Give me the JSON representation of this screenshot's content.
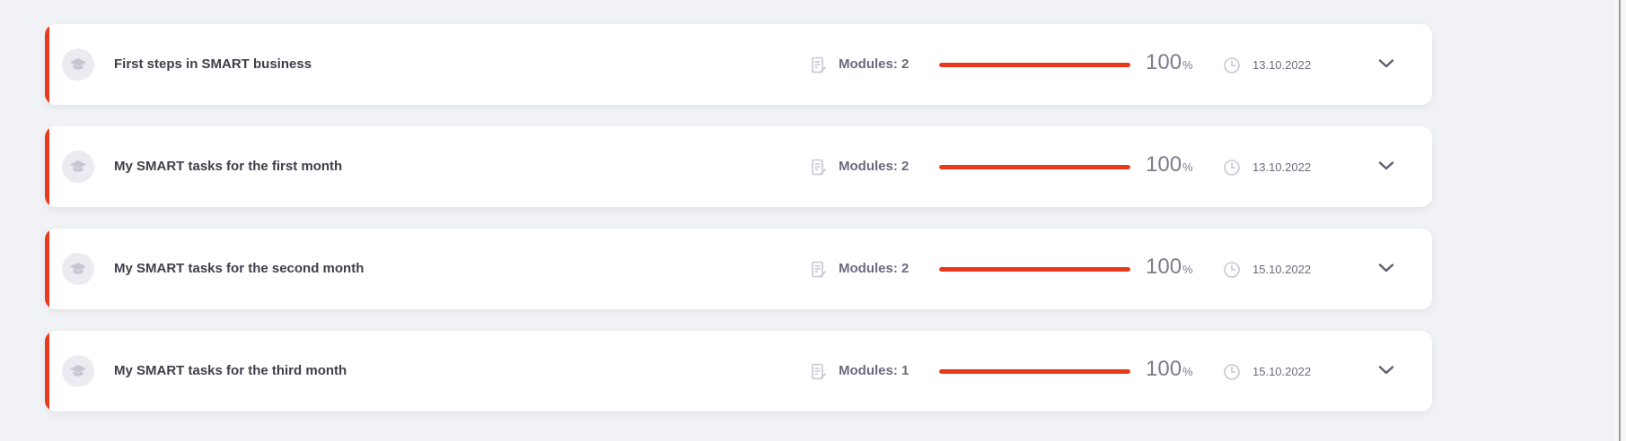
{
  "theme": {
    "accent": "#e8391a",
    "page_background": "#f1f2f5",
    "card_background": "#ffffff",
    "icon_muted": "#c6c7d2"
  },
  "icons": {
    "course": "graduation-cap-icon",
    "modules": "document-edit-icon",
    "date": "clock-icon",
    "expand": "chevron-down-icon"
  },
  "courses": [
    {
      "title": "First steps in SMART business",
      "modules_label": "Modules: 2",
      "progress": 100,
      "percent_sign": "%",
      "date": "13.10.2022"
    },
    {
      "title": "My SMART tasks for the first month",
      "modules_label": "Modules: 2",
      "progress": 100,
      "percent_sign": "%",
      "date": "13.10.2022"
    },
    {
      "title": "My SMART tasks for the second month",
      "modules_label": "Modules: 2",
      "progress": 100,
      "percent_sign": "%",
      "date": "15.10.2022"
    },
    {
      "title": "My SMART tasks for the third month",
      "modules_label": "Modules: 1",
      "progress": 100,
      "percent_sign": "%",
      "date": "15.10.2022"
    }
  ]
}
